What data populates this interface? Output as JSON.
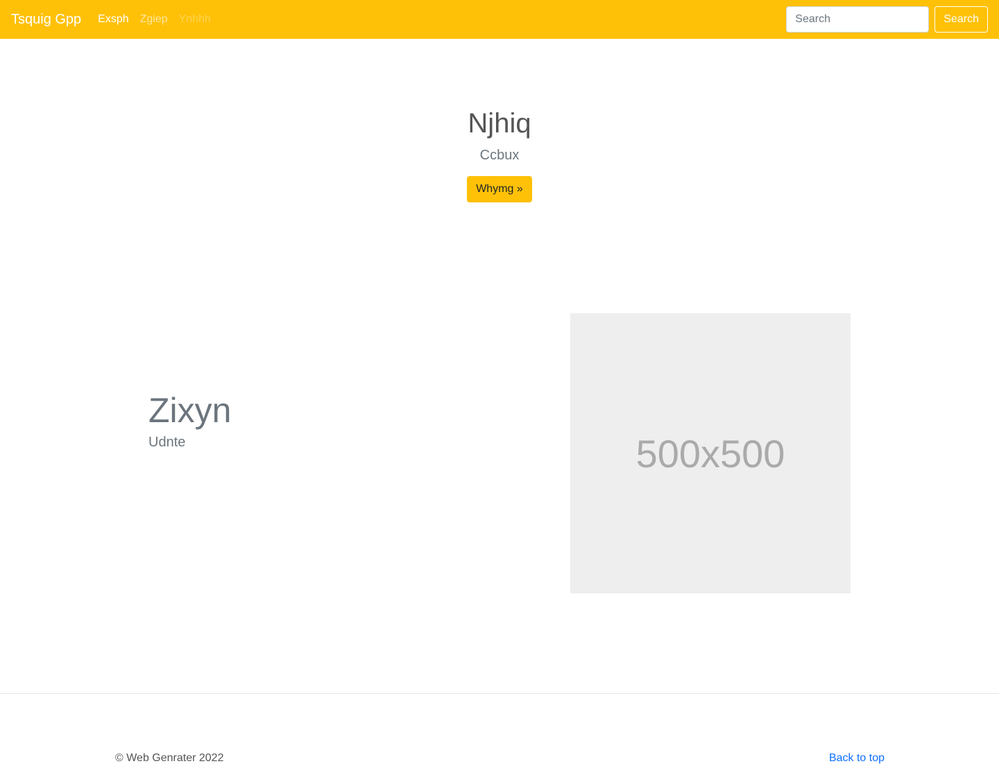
{
  "navbar": {
    "brand": "Tsquig Gpp",
    "links": [
      {
        "label": "Exsph",
        "state": "active"
      },
      {
        "label": "Zgiep",
        "state": "normal"
      },
      {
        "label": "Ynhhh",
        "state": "disabled"
      }
    ],
    "search": {
      "placeholder": "Search",
      "button_label": "Search"
    },
    "background_color": "#ffc107"
  },
  "hero": {
    "title": "Njhiq",
    "subtitle": "Ccbux",
    "button_label": "Whymg »"
  },
  "feature": {
    "heading": "Zixyn",
    "lead": "Udnte",
    "image_label": "500x500"
  },
  "footer": {
    "copyright": "© Web Genrater 2022",
    "back_to_top": "Back to top"
  }
}
